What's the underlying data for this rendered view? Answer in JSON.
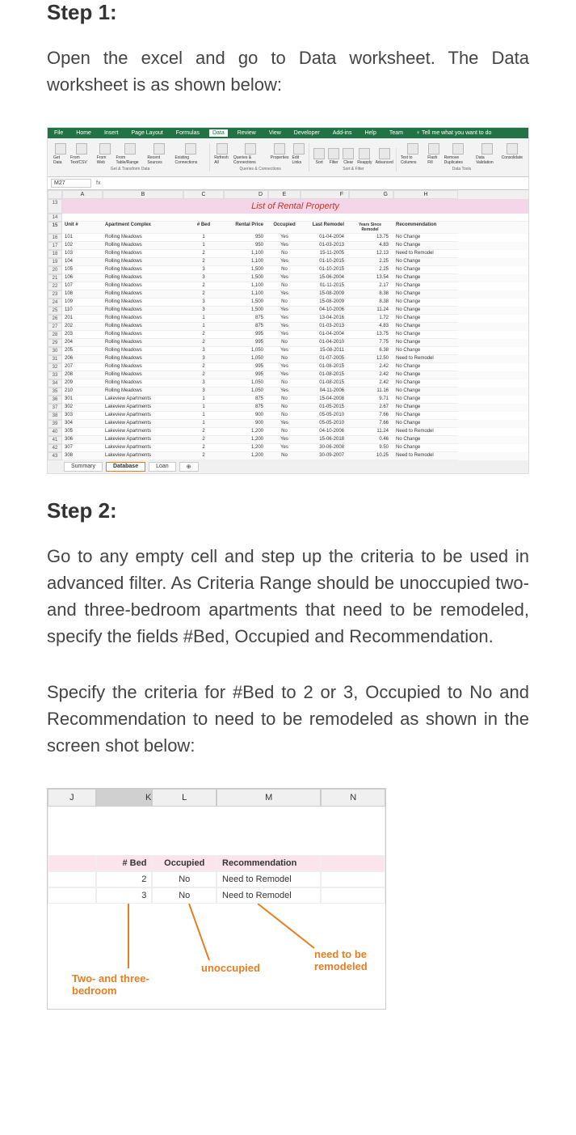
{
  "step1": {
    "heading": "Step 1:",
    "text": "Open the excel and go to Data worksheet. The Data worksheet is as shown below:"
  },
  "step2": {
    "heading": "Step 2:",
    "text1": "Go to any empty cell and step up the criteria to be used in advanced filter. As Criteria Range should be unoccupied two- and three-bedroom apartments that need to be remodeled, specify the fields #Bed, Occupied and Recommendation.",
    "text2": "Specify the criteria for #Bed to 2 or 3, Occupied to No and Recommendation to need to be remodeled as shown in the screen shot below:"
  },
  "excel": {
    "ribbon_tabs": [
      "File",
      "Home",
      "Insert",
      "Page Layout",
      "Formulas",
      "Data",
      "Review",
      "View",
      "Developer",
      "Add-ins",
      "Help",
      "Team"
    ],
    "active_tab": "Data",
    "tell_me": "Tell me what you want to do",
    "ribbon_groups": [
      {
        "label": "Get & Transform Data",
        "items": [
          "Get Data",
          "From Text/CSV",
          "From Web",
          "From Table/Range",
          "Recent Sources",
          "Existing Connections"
        ]
      },
      {
        "label": "Queries & Connections",
        "items": [
          "Refresh All",
          "Queries & Connections",
          "Properties",
          "Edit Links"
        ]
      },
      {
        "label": "Sort & Filter",
        "items": [
          "Sort",
          "Filter",
          "Clear",
          "Reapply",
          "Advanced"
        ]
      },
      {
        "label": "Data Tools",
        "items": [
          "Text to Columns",
          "Flash Fill",
          "Remove Duplicates",
          "Data Validation",
          "Consolidate"
        ]
      }
    ],
    "name_box": "M27",
    "column_letters": [
      "A",
      "B",
      "C",
      "D",
      "E",
      "F",
      "G",
      "H"
    ],
    "title": "List of Rental Property",
    "headers": [
      "Unit #",
      "Apartment Complex",
      "# Bed",
      "Rental Price",
      "Occupied",
      "Last Remodel",
      "Years Since Remodel",
      "Recommendation"
    ],
    "rows": [
      {
        "n": 16,
        "d": [
          "101",
          "Rolling Meadows",
          "1",
          "950",
          "Yes",
          "01-04-2004",
          "13.75",
          "No Change"
        ]
      },
      {
        "n": 17,
        "d": [
          "102",
          "Rolling Meadows",
          "1",
          "950",
          "Yes",
          "01-03-2013",
          "4.83",
          "No Change"
        ]
      },
      {
        "n": 18,
        "d": [
          "103",
          "Rolling Meadows",
          "2",
          "1,100",
          "No",
          "15-11-2005",
          "12.13",
          "Need to Remodel"
        ]
      },
      {
        "n": 19,
        "d": [
          "104",
          "Rolling Meadows",
          "2",
          "1,100",
          "Yes",
          "01-10-2015",
          "2.25",
          "No Change"
        ]
      },
      {
        "n": 20,
        "d": [
          "105",
          "Rolling Meadows",
          "3",
          "1,500",
          "No",
          "01-10-2015",
          "2.25",
          "No Change"
        ]
      },
      {
        "n": 21,
        "d": [
          "106",
          "Rolling Meadows",
          "3",
          "1,500",
          "Yes",
          "15-06-2004",
          "13.54",
          "No Change"
        ]
      },
      {
        "n": 22,
        "d": [
          "107",
          "Rolling Meadows",
          "2",
          "1,100",
          "No",
          "01-11-2015",
          "2.17",
          "No Change"
        ]
      },
      {
        "n": 23,
        "d": [
          "108",
          "Rolling Meadows",
          "2",
          "1,100",
          "Yes",
          "15-08-2009",
          "8.38",
          "No Change"
        ]
      },
      {
        "n": 24,
        "d": [
          "109",
          "Rolling Meadows",
          "3",
          "1,500",
          "No",
          "15-08-2009",
          "8.38",
          "No Change"
        ]
      },
      {
        "n": 25,
        "d": [
          "110",
          "Rolling Meadows",
          "3",
          "1,500",
          "Yes",
          "04-10-2006",
          "11.24",
          "No Change"
        ]
      },
      {
        "n": 26,
        "d": [
          "201",
          "Rolling Meadows",
          "1",
          "875",
          "Yes",
          "13-04-2016",
          "1.72",
          "No Change"
        ]
      },
      {
        "n": 27,
        "d": [
          "202",
          "Rolling Meadows",
          "1",
          "875",
          "Yes",
          "01-03-2013",
          "4.83",
          "No Change"
        ]
      },
      {
        "n": 28,
        "d": [
          "203",
          "Rolling Meadows",
          "2",
          "995",
          "Yes",
          "01-04-2004",
          "13.75",
          "No Change"
        ]
      },
      {
        "n": 29,
        "d": [
          "204",
          "Rolling Meadows",
          "2",
          "995",
          "No",
          "01-04-2010",
          "7.75",
          "No Change"
        ]
      },
      {
        "n": 30,
        "d": [
          "205",
          "Rolling Meadows",
          "3",
          "1,050",
          "Yes",
          "15-08-2011",
          "6.38",
          "No Change"
        ]
      },
      {
        "n": 31,
        "d": [
          "206",
          "Rolling Meadows",
          "3",
          "1,050",
          "No",
          "01-07-2005",
          "12.50",
          "Need to Remodel"
        ]
      },
      {
        "n": 32,
        "d": [
          "207",
          "Rolling Meadows",
          "2",
          "995",
          "Yes",
          "01-08-2015",
          "2.42",
          "No Change"
        ]
      },
      {
        "n": 33,
        "d": [
          "208",
          "Rolling Meadows",
          "2",
          "995",
          "Yes",
          "01-08-2015",
          "2.42",
          "No Change"
        ]
      },
      {
        "n": 34,
        "d": [
          "209",
          "Rolling Meadows",
          "3",
          "1,050",
          "No",
          "01-08-2015",
          "2.42",
          "No Change"
        ]
      },
      {
        "n": 35,
        "d": [
          "210",
          "Rolling Meadows",
          "3",
          "1,050",
          "Yes",
          "04-11-2006",
          "11.16",
          "No Change"
        ]
      },
      {
        "n": 36,
        "d": [
          "301",
          "Lakeview Apartments",
          "1",
          "875",
          "No",
          "15-04-2008",
          "9.71",
          "No Change"
        ]
      },
      {
        "n": 37,
        "d": [
          "302",
          "Lakeview Apartments",
          "1",
          "875",
          "No",
          "01-05-2015",
          "2.67",
          "No Change"
        ]
      },
      {
        "n": 38,
        "d": [
          "303",
          "Lakeview Apartments",
          "1",
          "900",
          "No",
          "05-05-2010",
          "7.66",
          "No Change"
        ]
      },
      {
        "n": 39,
        "d": [
          "304",
          "Lakeview Apartments",
          "1",
          "900",
          "Yes",
          "05-05-2010",
          "7.66",
          "No Change"
        ]
      },
      {
        "n": 40,
        "d": [
          "305",
          "Lakeview Apartments",
          "2",
          "1,200",
          "No",
          "04-10-2006",
          "11.24",
          "Need to Remodel"
        ]
      },
      {
        "n": 41,
        "d": [
          "306",
          "Lakeview Apartments",
          "2",
          "1,200",
          "Yes",
          "15-06-2018",
          "0.46",
          "No Change"
        ]
      },
      {
        "n": 42,
        "d": [
          "307",
          "Lakeview Apartments",
          "2",
          "1,200",
          "Yes",
          "30-06-2008",
          "9.50",
          "No Change"
        ]
      },
      {
        "n": 43,
        "d": [
          "308",
          "Lakeview Apartments",
          "2",
          "1,200",
          "No",
          "30-09-2007",
          "10.25",
          "Need to Remodel"
        ]
      }
    ],
    "sheet_tabs": [
      "Summary",
      "Database",
      "Loan"
    ],
    "active_sheet": "Database"
  },
  "criteria": {
    "column_letters": [
      "J",
      "K",
      "L",
      "M",
      "N"
    ],
    "headers": [
      "# Bed",
      "Occupied",
      "Recommendation"
    ],
    "rows": [
      [
        "2",
        "No",
        "Need to Remodel"
      ],
      [
        "3",
        "No",
        "Need to Remodel"
      ]
    ],
    "annotations": {
      "bed": "Two- and three-bedroom",
      "occupied": "unoccupied",
      "recommendation": "need to be remodeled"
    }
  }
}
